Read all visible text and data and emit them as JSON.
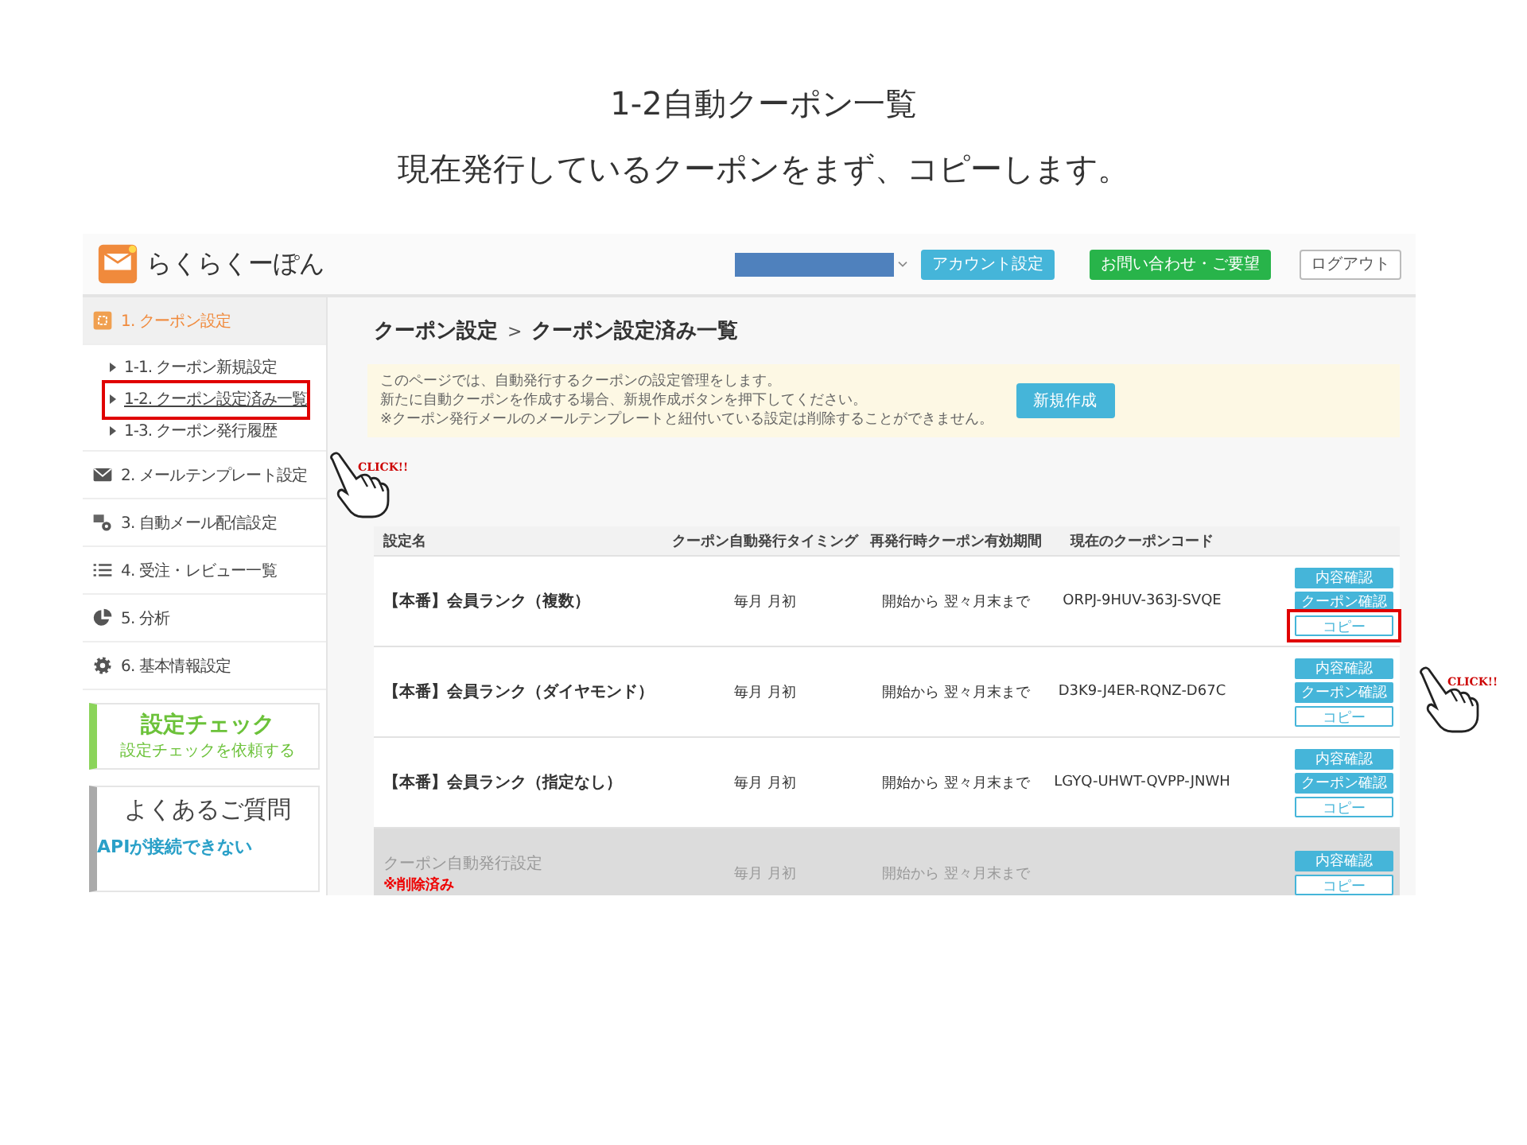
{
  "slide": {
    "title": "1-2自動クーポン一覧",
    "subtitle": "現在発行しているクーポンをまず、コピーします。"
  },
  "header": {
    "logo_text": "らくらくーぽん",
    "buttons": [
      {
        "label": "アカウント設定",
        "kind": "info"
      },
      {
        "label": "お問い合わせ・ご要望",
        "kind": "success"
      },
      {
        "label": "ログアウト",
        "kind": "plain"
      }
    ]
  },
  "sidebar": {
    "sections": [
      {
        "label": "1. クーポン設定",
        "selected": true,
        "children": [
          {
            "label": "1-1. クーポン新規設定",
            "selected": false,
            "highlighted": false
          },
          {
            "label": "1-2. クーポン設定済み一覧",
            "selected": true,
            "highlighted": true
          },
          {
            "label": "1-3. クーポン発行履歴",
            "selected": false,
            "highlighted": false
          }
        ]
      },
      {
        "label": "2. メールテンプレート設定",
        "selected": false
      },
      {
        "label": "3. 自動メール配信設定",
        "selected": false
      },
      {
        "label": "4. 受注・レビュー一覧",
        "selected": false
      },
      {
        "label": "5. 分析",
        "selected": false
      },
      {
        "label": "6. 基本情報設定",
        "selected": false
      }
    ],
    "check_card": {
      "title": "設定チェック",
      "subtitle": "設定チェックを依頼する"
    },
    "faq": {
      "title": "よくあるご質問",
      "links": [
        "APIが接続できない"
      ]
    }
  },
  "main": {
    "breadcrumb": [
      "クーポン設定",
      "クーポン設定済み一覧"
    ],
    "breadcrumb_separator": ">",
    "notice": {
      "lines": [
        "このページでは、自動発行するクーポンの設定管理をします。",
        "新たに自動クーポンを作成する場合、新規作成ボタンを押下してください。",
        "※クーポン発行メールのメールテンプレートと紐付いている設定は削除することができません。"
      ],
      "button": "新規作成"
    },
    "table": {
      "columns": [
        "設定名",
        "クーポン自動発行タイミング",
        "再発行時クーポン有効期間",
        "現在のクーポンコード"
      ],
      "rows": [
        {
          "name": "【本番】会員ランク（複数）",
          "deleted": false,
          "timing": "毎月 月初",
          "period": "開始から 翌々月末まで",
          "code": "ORPJ-9HUV-363J-SVQE",
          "actions": [
            {
              "label": "内容確認",
              "kind": "filled",
              "highlighted": false
            },
            {
              "label": "クーポン確認",
              "kind": "filled",
              "highlighted": false
            },
            {
              "label": "コピー",
              "kind": "outline",
              "highlighted": true
            }
          ]
        },
        {
          "name": "【本番】会員ランク（ダイヤモンド）",
          "deleted": false,
          "timing": "毎月 月初",
          "period": "開始から 翌々月末まで",
          "code": "D3K9-J4ER-RQNZ-D67C",
          "actions": [
            {
              "label": "内容確認",
              "kind": "filled",
              "highlighted": false
            },
            {
              "label": "クーポン確認",
              "kind": "filled",
              "highlighted": false
            },
            {
              "label": "コピー",
              "kind": "outline",
              "highlighted": false
            }
          ]
        },
        {
          "name": "【本番】会員ランク（指定なし）",
          "deleted": false,
          "timing": "毎月 月初",
          "period": "開始から 翌々月末まで",
          "code": "LGYQ-UHWT-QVPP-JNWH",
          "actions": [
            {
              "label": "内容確認",
              "kind": "filled",
              "highlighted": false
            },
            {
              "label": "クーポン確認",
              "kind": "filled",
              "highlighted": false
            },
            {
              "label": "コピー",
              "kind": "outline",
              "highlighted": false
            }
          ]
        },
        {
          "name": "クーポン自動発行設定",
          "note": "※削除済み",
          "deleted": true,
          "timing": "毎月 月初",
          "period": "開始から 翌々月末まで",
          "actions": [
            {
              "label": "内容確認",
              "kind": "filled",
              "highlighted": false
            },
            {
              "label": "コピー",
              "kind": "outline",
              "highlighted": false
            }
          ]
        }
      ]
    }
  },
  "annotations": [
    {
      "label": "CLICK!!"
    },
    {
      "label": "CLICK!!"
    }
  ]
}
